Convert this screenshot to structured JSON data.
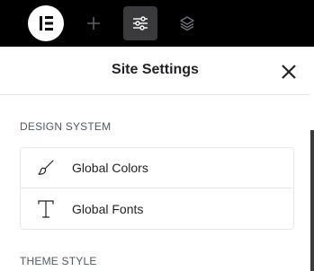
{
  "topbar": {
    "logo_icon": "elementor-logo-icon",
    "add_icon": "plus-icon",
    "settings_icon": "sliders-icon",
    "layers_icon": "layers-icon"
  },
  "panel": {
    "title": "Site Settings",
    "close_icon": "close-icon",
    "sections": {
      "design_system": {
        "label": "DESIGN SYSTEM",
        "items": [
          {
            "label": "Global Colors",
            "icon": "brush-icon"
          },
          {
            "label": "Global Fonts",
            "icon": "typography-icon"
          }
        ]
      },
      "theme_style": {
        "label": "THEME STYLE"
      }
    }
  },
  "colors": {
    "topbar_bg": "#000000",
    "active_button_bg": "#3a3a3d",
    "text_primary": "#1f2124",
    "text_secondary": "#515962",
    "border": "#e6e8ea"
  }
}
